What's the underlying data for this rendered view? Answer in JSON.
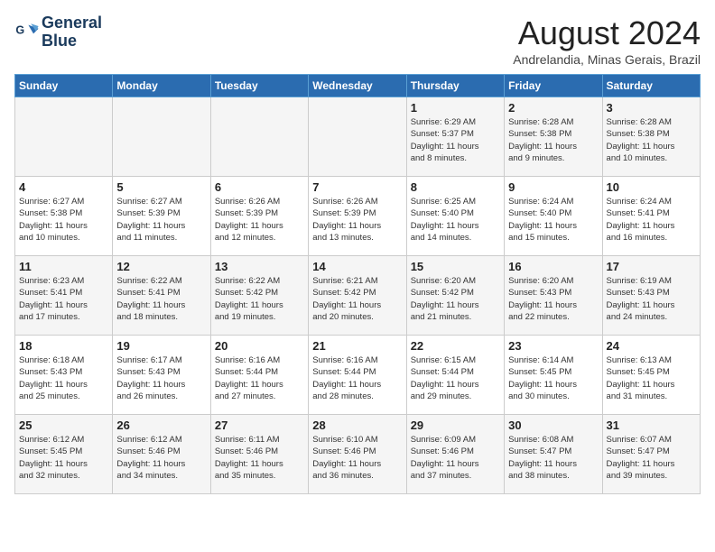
{
  "header": {
    "logo_line1": "General",
    "logo_line2": "Blue",
    "month": "August 2024",
    "location": "Andrelandia, Minas Gerais, Brazil"
  },
  "days_of_week": [
    "Sunday",
    "Monday",
    "Tuesday",
    "Wednesday",
    "Thursday",
    "Friday",
    "Saturday"
  ],
  "weeks": [
    [
      {
        "day": "",
        "info": ""
      },
      {
        "day": "",
        "info": ""
      },
      {
        "day": "",
        "info": ""
      },
      {
        "day": "",
        "info": ""
      },
      {
        "day": "1",
        "info": "Sunrise: 6:29 AM\nSunset: 5:37 PM\nDaylight: 11 hours\nand 8 minutes."
      },
      {
        "day": "2",
        "info": "Sunrise: 6:28 AM\nSunset: 5:38 PM\nDaylight: 11 hours\nand 9 minutes."
      },
      {
        "day": "3",
        "info": "Sunrise: 6:28 AM\nSunset: 5:38 PM\nDaylight: 11 hours\nand 10 minutes."
      }
    ],
    [
      {
        "day": "4",
        "info": "Sunrise: 6:27 AM\nSunset: 5:38 PM\nDaylight: 11 hours\nand 10 minutes."
      },
      {
        "day": "5",
        "info": "Sunrise: 6:27 AM\nSunset: 5:39 PM\nDaylight: 11 hours\nand 11 minutes."
      },
      {
        "day": "6",
        "info": "Sunrise: 6:26 AM\nSunset: 5:39 PM\nDaylight: 11 hours\nand 12 minutes."
      },
      {
        "day": "7",
        "info": "Sunrise: 6:26 AM\nSunset: 5:39 PM\nDaylight: 11 hours\nand 13 minutes."
      },
      {
        "day": "8",
        "info": "Sunrise: 6:25 AM\nSunset: 5:40 PM\nDaylight: 11 hours\nand 14 minutes."
      },
      {
        "day": "9",
        "info": "Sunrise: 6:24 AM\nSunset: 5:40 PM\nDaylight: 11 hours\nand 15 minutes."
      },
      {
        "day": "10",
        "info": "Sunrise: 6:24 AM\nSunset: 5:41 PM\nDaylight: 11 hours\nand 16 minutes."
      }
    ],
    [
      {
        "day": "11",
        "info": "Sunrise: 6:23 AM\nSunset: 5:41 PM\nDaylight: 11 hours\nand 17 minutes."
      },
      {
        "day": "12",
        "info": "Sunrise: 6:22 AM\nSunset: 5:41 PM\nDaylight: 11 hours\nand 18 minutes."
      },
      {
        "day": "13",
        "info": "Sunrise: 6:22 AM\nSunset: 5:42 PM\nDaylight: 11 hours\nand 19 minutes."
      },
      {
        "day": "14",
        "info": "Sunrise: 6:21 AM\nSunset: 5:42 PM\nDaylight: 11 hours\nand 20 minutes."
      },
      {
        "day": "15",
        "info": "Sunrise: 6:20 AM\nSunset: 5:42 PM\nDaylight: 11 hours\nand 21 minutes."
      },
      {
        "day": "16",
        "info": "Sunrise: 6:20 AM\nSunset: 5:43 PM\nDaylight: 11 hours\nand 22 minutes."
      },
      {
        "day": "17",
        "info": "Sunrise: 6:19 AM\nSunset: 5:43 PM\nDaylight: 11 hours\nand 24 minutes."
      }
    ],
    [
      {
        "day": "18",
        "info": "Sunrise: 6:18 AM\nSunset: 5:43 PM\nDaylight: 11 hours\nand 25 minutes."
      },
      {
        "day": "19",
        "info": "Sunrise: 6:17 AM\nSunset: 5:43 PM\nDaylight: 11 hours\nand 26 minutes."
      },
      {
        "day": "20",
        "info": "Sunrise: 6:16 AM\nSunset: 5:44 PM\nDaylight: 11 hours\nand 27 minutes."
      },
      {
        "day": "21",
        "info": "Sunrise: 6:16 AM\nSunset: 5:44 PM\nDaylight: 11 hours\nand 28 minutes."
      },
      {
        "day": "22",
        "info": "Sunrise: 6:15 AM\nSunset: 5:44 PM\nDaylight: 11 hours\nand 29 minutes."
      },
      {
        "day": "23",
        "info": "Sunrise: 6:14 AM\nSunset: 5:45 PM\nDaylight: 11 hours\nand 30 minutes."
      },
      {
        "day": "24",
        "info": "Sunrise: 6:13 AM\nSunset: 5:45 PM\nDaylight: 11 hours\nand 31 minutes."
      }
    ],
    [
      {
        "day": "25",
        "info": "Sunrise: 6:12 AM\nSunset: 5:45 PM\nDaylight: 11 hours\nand 32 minutes."
      },
      {
        "day": "26",
        "info": "Sunrise: 6:12 AM\nSunset: 5:46 PM\nDaylight: 11 hours\nand 34 minutes."
      },
      {
        "day": "27",
        "info": "Sunrise: 6:11 AM\nSunset: 5:46 PM\nDaylight: 11 hours\nand 35 minutes."
      },
      {
        "day": "28",
        "info": "Sunrise: 6:10 AM\nSunset: 5:46 PM\nDaylight: 11 hours\nand 36 minutes."
      },
      {
        "day": "29",
        "info": "Sunrise: 6:09 AM\nSunset: 5:46 PM\nDaylight: 11 hours\nand 37 minutes."
      },
      {
        "day": "30",
        "info": "Sunrise: 6:08 AM\nSunset: 5:47 PM\nDaylight: 11 hours\nand 38 minutes."
      },
      {
        "day": "31",
        "info": "Sunrise: 6:07 AM\nSunset: 5:47 PM\nDaylight: 11 hours\nand 39 minutes."
      }
    ]
  ]
}
